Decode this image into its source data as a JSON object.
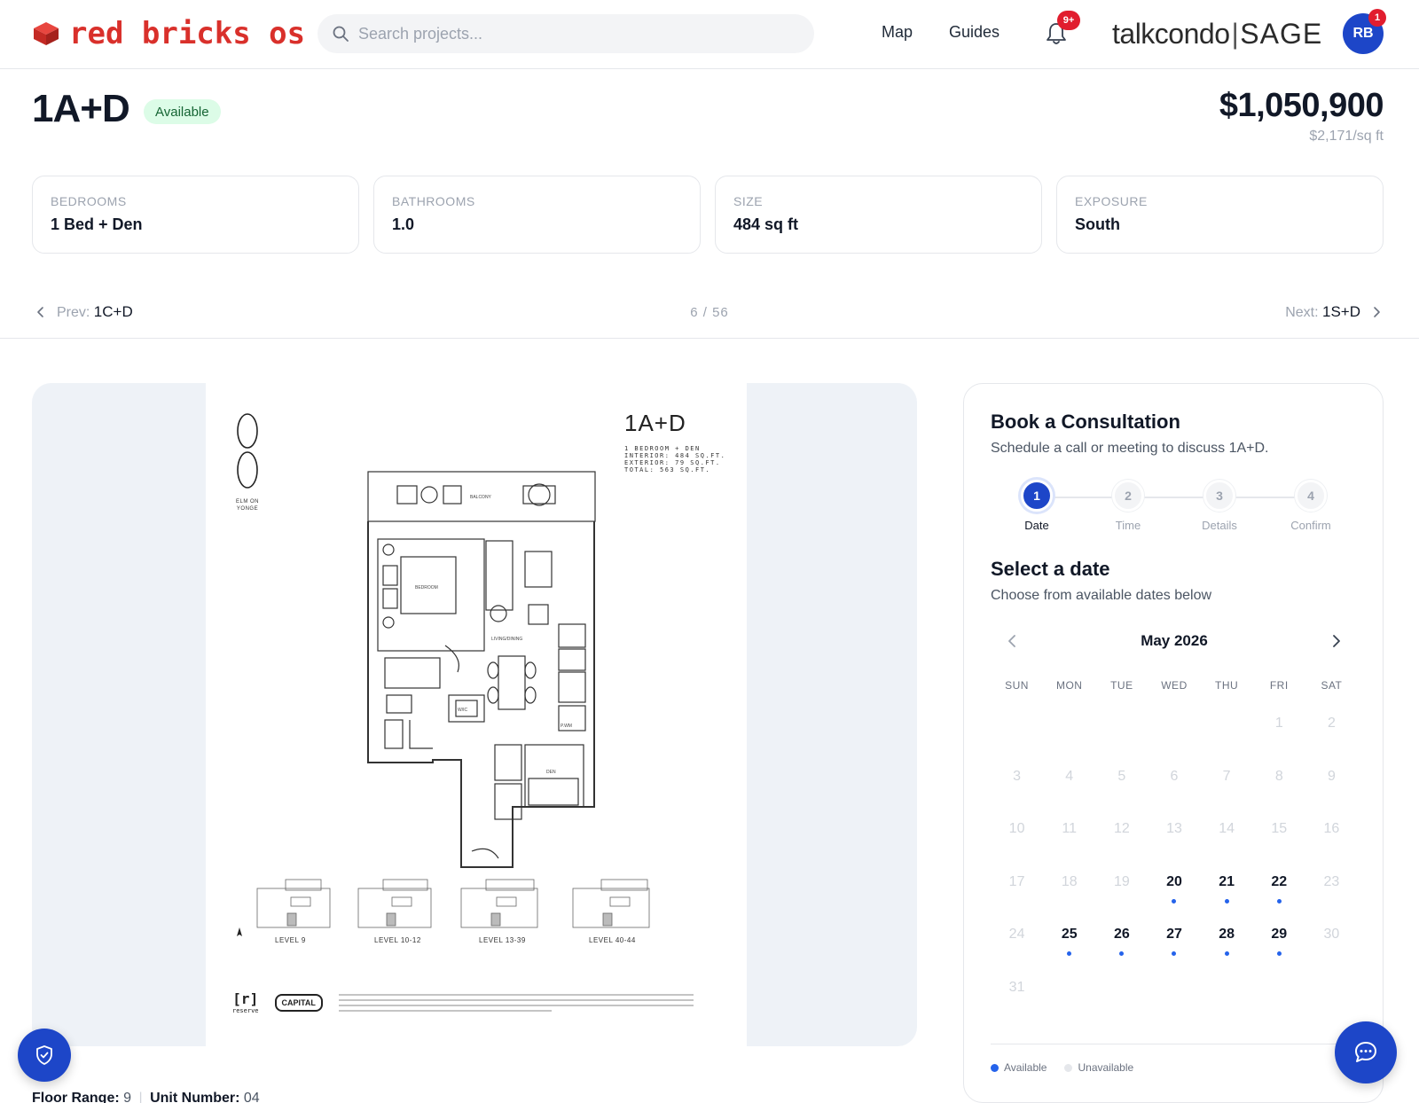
{
  "header": {
    "logo_text": "red bricks os",
    "search_placeholder": "Search projects...",
    "nav": {
      "map": "Map",
      "guides": "Guides"
    },
    "notification_count": "9+",
    "partner_left": "talkcondo",
    "partner_right": "SAGE",
    "avatar_initials": "RB",
    "avatar_badge": "1"
  },
  "unit": {
    "name": "1A+D",
    "status": "Available",
    "price": "$1,050,900",
    "price_per_sqft": "$2,171/sq ft",
    "stats": [
      {
        "label": "BEDROOMS",
        "value": "1 Bed + Den"
      },
      {
        "label": "BATHROOMS",
        "value": "1.0"
      },
      {
        "label": "SIZE",
        "value": "484 sq ft"
      },
      {
        "label": "EXPOSURE",
        "value": "South"
      }
    ]
  },
  "pager": {
    "prev_label": "Prev:",
    "prev_unit": "1C+D",
    "count": "6 / 56",
    "next_label": "Next:",
    "next_unit": "1S+D"
  },
  "floorplan": {
    "unit_label": "1A+D",
    "brand_lines": "ELM ON YONGE",
    "spec_lines": [
      "1 BEDROOM + DEN",
      "INTERIOR: 484 SQ.FT.",
      "EXTERIOR: 79 SQ.FT.",
      "TOTAL: 563 SQ.FT."
    ],
    "rooms": {
      "balcony": "BALCONY",
      "bedroom": "BEDROOM",
      "living": "LIVING/DINING",
      "den": "DEN",
      "wic": "W/IC",
      "pwdr": "P.WM"
    },
    "levels": [
      "LEVEL 9",
      "LEVEL 10-12",
      "LEVEL 13-39",
      "LEVEL 40-44"
    ],
    "reserve_mark": "[r]",
    "reserve_text": "reserve",
    "capital_text": "CAPITAL"
  },
  "booking": {
    "title": "Book a Consultation",
    "subtitle": "Schedule a call or meeting to discuss 1A+D.",
    "steps": [
      {
        "num": "1",
        "label": "Date"
      },
      {
        "num": "2",
        "label": "Time"
      },
      {
        "num": "3",
        "label": "Details"
      },
      {
        "num": "4",
        "label": "Confirm"
      }
    ],
    "select_title": "Select a date",
    "select_sub": "Choose from available dates below",
    "month": "May 2026",
    "weekdays": [
      "SUN",
      "MON",
      "TUE",
      "WED",
      "THU",
      "FRI",
      "SAT"
    ],
    "first_weekday_index": 5,
    "days_in_month": 31,
    "available_days": [
      20,
      21,
      22,
      25,
      26,
      27,
      28,
      29
    ],
    "legend_available": "Available",
    "legend_unavailable": "Unavailable",
    "colors": {
      "available": "#2563eb",
      "unavailable": "#e5e7eb",
      "accent": "#1d46c8"
    }
  },
  "floor_info": {
    "range_label": "Floor Range:",
    "range_value": "9",
    "unit_label": "Unit Number:",
    "unit_value": "04"
  }
}
